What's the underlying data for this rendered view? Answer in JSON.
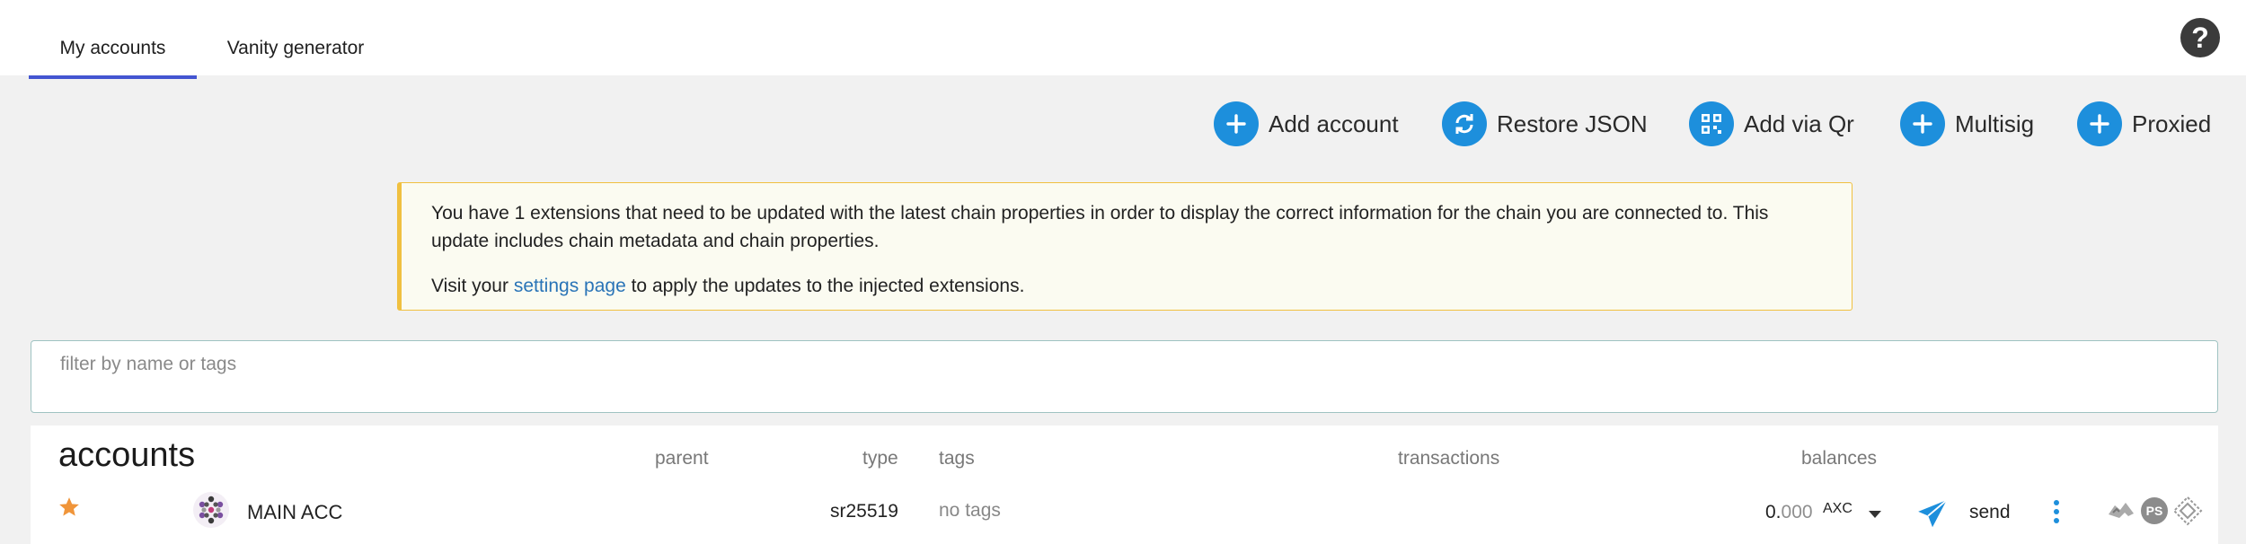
{
  "tabs": [
    {
      "label": "My accounts",
      "active": true
    },
    {
      "label": "Vanity generator",
      "active": false
    }
  ],
  "help": {
    "icon": "help-circle-icon",
    "glyph": "?"
  },
  "actions": [
    {
      "label": "Add account",
      "icon": "plus-icon"
    },
    {
      "label": "Restore JSON",
      "icon": "sync-icon"
    },
    {
      "label": "Add via Qr",
      "icon": "qrcode-icon"
    },
    {
      "label": "Multisig",
      "icon": "plus-icon"
    },
    {
      "label": "Proxied",
      "icon": "plus-icon"
    }
  ],
  "warning": {
    "line1": "You have 1 extensions that need to be updated with the latest chain properties in order to display the correct information for the chain you are connected to. This update includes chain metadata and chain properties.",
    "line2_prefix": "Visit your ",
    "line2_link": "settings page",
    "line2_suffix": " to apply the updates to the injected extensions."
  },
  "filter": {
    "placeholder": "filter by name or tags",
    "value": ""
  },
  "table": {
    "title": "accounts",
    "headers": {
      "parent": "parent",
      "type": "type",
      "tags": "tags",
      "transactions": "transactions",
      "balances": "balances"
    },
    "rows": [
      {
        "name": "MAIN ACC",
        "type": "sr25519",
        "tags": "no tags",
        "balance_int": "0.",
        "balance_dec": "000",
        "unit": "AXC",
        "send_label": "send",
        "extensions": [
          "polkadot-js-icon",
          "PS",
          "talisman-icon"
        ]
      }
    ]
  },
  "colors": {
    "accent": "#1d8fdc",
    "tab_underline": "#4355d1",
    "warning_border": "#f0c040",
    "star": "#f0953a",
    "link": "#2a74b7"
  }
}
